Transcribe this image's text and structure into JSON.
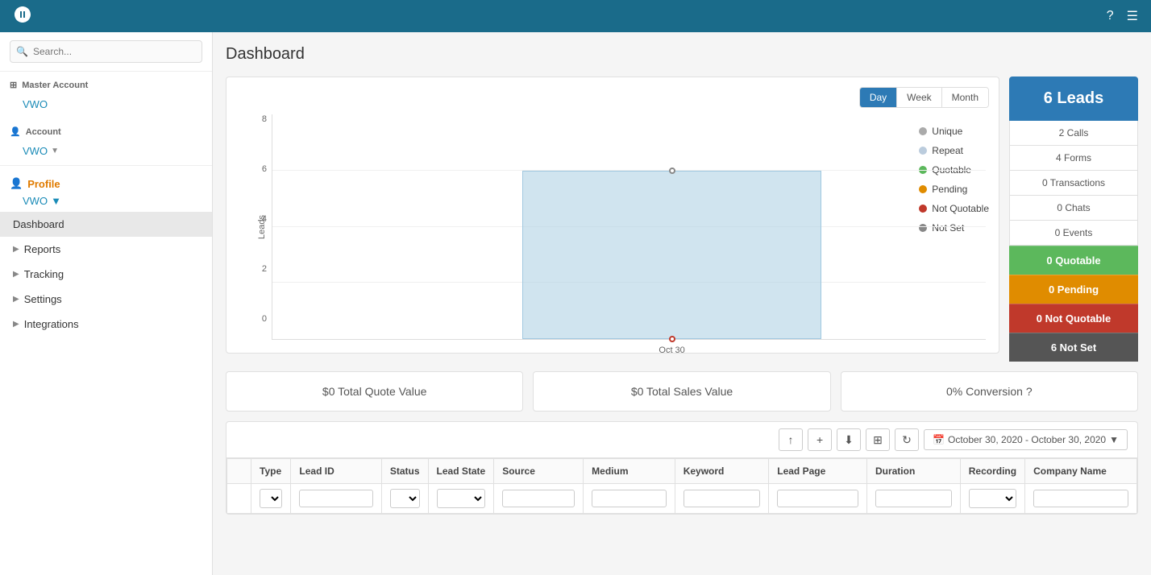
{
  "topNav": {
    "logo": "⟳",
    "helpIcon": "?",
    "userIcon": "☰"
  },
  "sidebar": {
    "searchPlaceholder": "Search...",
    "masterAccount": {
      "label": "Master Account",
      "accountName": "VWO"
    },
    "account": {
      "label": "Account",
      "icon": "👤",
      "accountName": "VWO"
    },
    "profile": {
      "label": "Profile",
      "accountName": "VWO"
    },
    "navItems": [
      {
        "label": "Dashboard",
        "active": true
      },
      {
        "label": "Reports",
        "active": false
      },
      {
        "label": "Tracking",
        "active": false
      },
      {
        "label": "Settings",
        "active": false
      },
      {
        "label": "Integrations",
        "active": false
      }
    ]
  },
  "dashboard": {
    "title": "Dashboard",
    "chart": {
      "xLabel": "Oct 30",
      "yLabels": [
        "8",
        "6",
        "4",
        "2",
        "0"
      ],
      "axisLabel": "Leads",
      "dayLabel": "Day",
      "weekLabel": "Week",
      "monthLabel": "Month",
      "legend": [
        {
          "label": "Unique",
          "color": "#aaaaaa",
          "type": "circle"
        },
        {
          "label": "Repeat",
          "color": "#bbccdd",
          "type": "circle"
        },
        {
          "label": "Quotable",
          "color": "#5cb85c",
          "type": "circle"
        },
        {
          "label": "Pending",
          "color": "#e08c00",
          "type": "circle"
        },
        {
          "label": "Not Quotable",
          "color": "#c0392b",
          "type": "circle"
        },
        {
          "label": "Not Set",
          "color": "#888888",
          "type": "circle"
        }
      ]
    },
    "stats": {
      "leadsLabel": "6 Leads",
      "rows": [
        {
          "label": "2 Calls"
        },
        {
          "label": "4 Forms"
        },
        {
          "label": "0 Transactions"
        },
        {
          "label": "0 Chats"
        },
        {
          "label": "0 Events"
        }
      ],
      "buttons": [
        {
          "label": "0 Quotable",
          "color": "green"
        },
        {
          "label": "0 Pending",
          "color": "orange"
        },
        {
          "label": "0 Not Quotable",
          "color": "red"
        },
        {
          "label": "6 Not Set",
          "color": "dark"
        }
      ]
    },
    "metrics": [
      {
        "label": "$0 Total Quote Value"
      },
      {
        "label": "$0 Total Sales Value"
      },
      {
        "label": "0% Conversion ?"
      }
    ],
    "tableToolbar": {
      "dateRange": "October 30, 2020 - October 30, 2020"
    },
    "tableHeaders": [
      "Type",
      "Lead ID",
      "Status",
      "Lead State",
      "Source",
      "Medium",
      "Keyword",
      "Lead Page",
      "Duration",
      "Recording",
      "Company Name"
    ]
  }
}
